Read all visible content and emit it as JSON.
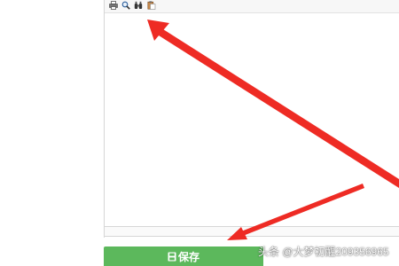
{
  "toolbar": {
    "icons": [
      "print-icon",
      "preview-icon",
      "find-icon",
      "paste-icon"
    ]
  },
  "save_button": {
    "label": "保存",
    "icon": "save-icon",
    "color": "#5cb85c"
  },
  "watermark": {
    "text": "头条 @大梦初醒209356965"
  },
  "annotations": {
    "arrow_color": "#ee2b24"
  }
}
